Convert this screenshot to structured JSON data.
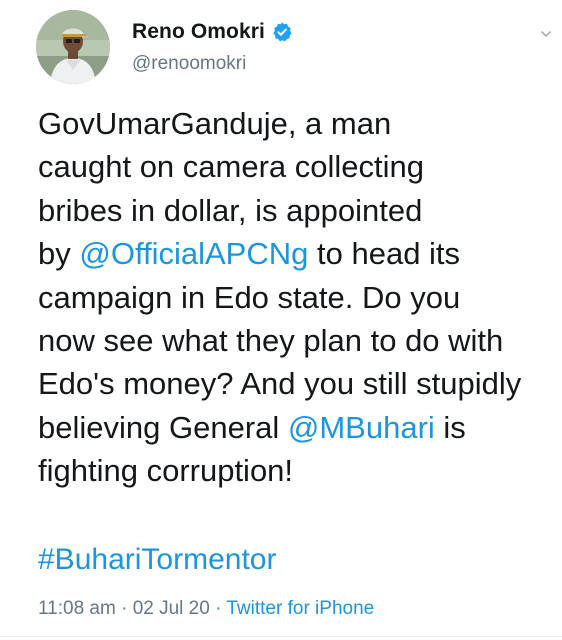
{
  "author": {
    "display_name": "Reno Omokri",
    "handle": "@renoomokri",
    "verified_icon": "verified-badge-icon",
    "avatar": "profile-photo-avatar"
  },
  "tweet": {
    "lines": [
      [
        "GovUmarGanduje, a man",
        "",
        ""
      ],
      [
        "caught on camera collecting",
        "",
        ""
      ],
      [
        "bribes in dollar, is appointed",
        "",
        ""
      ],
      [
        "by ",
        "@OfficialAPCNg",
        " to head its"
      ],
      [
        "campaign in Edo state. Do you",
        "",
        ""
      ],
      [
        "now see what they plan to do with",
        "",
        ""
      ],
      [
        "Edo's money? And you still stupidly",
        "",
        ""
      ],
      [
        "believing General ",
        "@MBuhari",
        " is"
      ],
      [
        "fighting corruption!",
        "",
        ""
      ]
    ],
    "hashtag": "#BuhariTormentor"
  },
  "meta": {
    "time": "11:08 am",
    "separator": " · ",
    "date": "02 Jul 20",
    "source": "Twitter for iPhone"
  },
  "colors": {
    "link": "#1b95e0",
    "muted": "#657786",
    "text": "#14171a",
    "verified": "#1da1f2"
  },
  "icons": {
    "more": "chevron-down-icon"
  }
}
